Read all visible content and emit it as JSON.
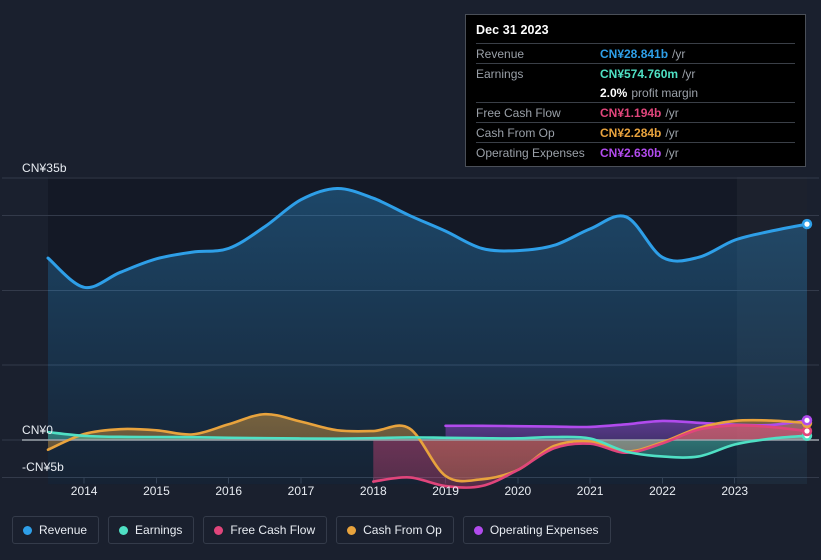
{
  "colors": {
    "background": "#1a202e",
    "revenue": "#2e9fe8",
    "earnings": "#4fe0c4",
    "free_cash_flow": "#e0457b",
    "cash_from_op": "#e8a33d",
    "operating_expenses": "#b14bed",
    "gridline": "#333a4a",
    "zero_line": "#9aa0a8",
    "axis_text": "#e8ecf2"
  },
  "tooltip": {
    "date": "Dec 31 2023",
    "rows": [
      {
        "key": "Revenue",
        "value": "CN¥28.841b",
        "suffix": "/yr",
        "color": "#2e9fe8",
        "rule": true
      },
      {
        "key": "Earnings",
        "value": "CN¥574.760m",
        "suffix": "/yr",
        "color": "#4fe0c4",
        "rule": true
      },
      {
        "key": "",
        "value": "2.0%",
        "suffix": "profit margin",
        "color": "#ffffff",
        "rule": false
      },
      {
        "key": "Free Cash Flow",
        "value": "CN¥1.194b",
        "suffix": "/yr",
        "color": "#e0457b",
        "rule": true
      },
      {
        "key": "Cash From Op",
        "value": "CN¥2.284b",
        "suffix": "/yr",
        "color": "#e8a33d",
        "rule": true
      },
      {
        "key": "Operating Expenses",
        "value": "CN¥2.630b",
        "suffix": "/yr",
        "color": "#b14bed",
        "rule": true
      }
    ]
  },
  "legend": [
    {
      "label": "Revenue",
      "color": "#2e9fe8"
    },
    {
      "label": "Earnings",
      "color": "#4fe0c4"
    },
    {
      "label": "Free Cash Flow",
      "color": "#e0457b"
    },
    {
      "label": "Cash From Op",
      "color": "#e8a33d"
    },
    {
      "label": "Operating Expenses",
      "color": "#b14bed"
    }
  ],
  "chart_data": {
    "type": "area",
    "title": "",
    "xlabel": "",
    "ylabel": "",
    "currency": "CN¥",
    "units": "billions",
    "ylim": [
      -5,
      35
    ],
    "y_ticks": [
      {
        "label": "CN¥35b",
        "value": 35
      },
      {
        "label": "CN¥0",
        "value": 0
      },
      {
        "label": "-CN¥5b",
        "value": -5
      }
    ],
    "gridlines": [
      35,
      30,
      20,
      10,
      0,
      -5
    ],
    "x_ticks": [
      "2014",
      "2015",
      "2016",
      "2017",
      "2018",
      "2019",
      "2020",
      "2021",
      "2022",
      "2023"
    ],
    "x_range": [
      2013.5,
      2024.0
    ],
    "highlight_band": {
      "from": 2023.03,
      "to": 2024.0,
      "label": ""
    },
    "legend_position": "bottom",
    "grid": true,
    "x": [
      2013.5,
      2014.0,
      2014.5,
      2015.0,
      2015.5,
      2016.0,
      2016.5,
      2017.0,
      2017.5,
      2018.0,
      2018.5,
      2019.0,
      2019.5,
      2020.0,
      2020.5,
      2021.0,
      2021.5,
      2022.0,
      2022.5,
      2023.0,
      2023.5,
      2024.0
    ],
    "series": [
      {
        "name": "Revenue",
        "color": "#2e9fe8",
        "filled": true,
        "end_marker": true,
        "values": [
          24.3,
          20.4,
          22.4,
          24.2,
          25.1,
          25.6,
          28.5,
          32.1,
          33.6,
          32.3,
          30.0,
          27.9,
          25.6,
          25.3,
          26.0,
          28.2,
          29.8,
          24.4,
          24.4,
          26.7,
          27.9,
          28.841
        ]
      },
      {
        "name": "Earnings",
        "color": "#4fe0c4",
        "filled": true,
        "end_marker": true,
        "values": [
          1.05,
          0.55,
          0.42,
          0.4,
          0.38,
          0.3,
          0.25,
          0.2,
          0.18,
          0.25,
          0.35,
          0.3,
          0.25,
          0.22,
          0.4,
          0.2,
          -1.55,
          -2.2,
          -2.2,
          -0.6,
          0.18,
          0.575
        ]
      },
      {
        "name": "Free Cash Flow",
        "color": "#e0457b",
        "filled": true,
        "end_marker": true,
        "values": [
          null,
          null,
          null,
          null,
          null,
          null,
          null,
          null,
          null,
          -5.55,
          -5.0,
          -6.15,
          -6.15,
          -4.0,
          -1.1,
          -0.5,
          -1.7,
          -0.45,
          1.4,
          1.95,
          1.75,
          1.194
        ]
      },
      {
        "name": "Cash From Op",
        "color": "#e8a33d",
        "filled": true,
        "end_marker": true,
        "values": [
          -1.3,
          0.8,
          1.45,
          1.3,
          0.75,
          2.1,
          3.45,
          2.45,
          1.3,
          1.2,
          1.55,
          -4.8,
          -5.25,
          -4.0,
          -0.8,
          -0.2,
          -1.55,
          -0.3,
          1.6,
          2.55,
          2.6,
          2.284
        ]
      },
      {
        "name": "Operating Expenses",
        "color": "#b14bed",
        "filled": true,
        "end_marker": true,
        "values": [
          null,
          null,
          null,
          null,
          null,
          null,
          null,
          null,
          null,
          null,
          null,
          1.9,
          1.9,
          1.85,
          1.8,
          1.75,
          2.1,
          2.55,
          2.3,
          2.05,
          2.0,
          2.63
        ]
      }
    ]
  }
}
